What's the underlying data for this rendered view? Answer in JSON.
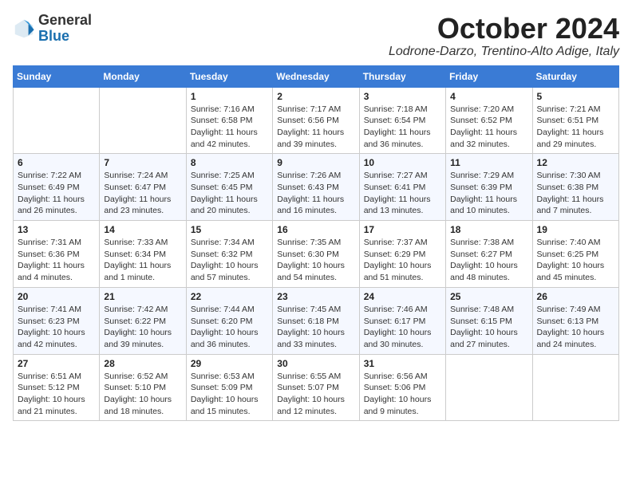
{
  "header": {
    "logo_general": "General",
    "logo_blue": "Blue",
    "month_title": "October 2024",
    "subtitle": "Lodrone-Darzo, Trentino-Alto Adige, Italy"
  },
  "days_of_week": [
    "Sunday",
    "Monday",
    "Tuesday",
    "Wednesday",
    "Thursday",
    "Friday",
    "Saturday"
  ],
  "weeks": [
    [
      {
        "day": "",
        "info": ""
      },
      {
        "day": "",
        "info": ""
      },
      {
        "day": "1",
        "info": "Sunrise: 7:16 AM\nSunset: 6:58 PM\nDaylight: 11 hours and 42 minutes."
      },
      {
        "day": "2",
        "info": "Sunrise: 7:17 AM\nSunset: 6:56 PM\nDaylight: 11 hours and 39 minutes."
      },
      {
        "day": "3",
        "info": "Sunrise: 7:18 AM\nSunset: 6:54 PM\nDaylight: 11 hours and 36 minutes."
      },
      {
        "day": "4",
        "info": "Sunrise: 7:20 AM\nSunset: 6:52 PM\nDaylight: 11 hours and 32 minutes."
      },
      {
        "day": "5",
        "info": "Sunrise: 7:21 AM\nSunset: 6:51 PM\nDaylight: 11 hours and 29 minutes."
      }
    ],
    [
      {
        "day": "6",
        "info": "Sunrise: 7:22 AM\nSunset: 6:49 PM\nDaylight: 11 hours and 26 minutes."
      },
      {
        "day": "7",
        "info": "Sunrise: 7:24 AM\nSunset: 6:47 PM\nDaylight: 11 hours and 23 minutes."
      },
      {
        "day": "8",
        "info": "Sunrise: 7:25 AM\nSunset: 6:45 PM\nDaylight: 11 hours and 20 minutes."
      },
      {
        "day": "9",
        "info": "Sunrise: 7:26 AM\nSunset: 6:43 PM\nDaylight: 11 hours and 16 minutes."
      },
      {
        "day": "10",
        "info": "Sunrise: 7:27 AM\nSunset: 6:41 PM\nDaylight: 11 hours and 13 minutes."
      },
      {
        "day": "11",
        "info": "Sunrise: 7:29 AM\nSunset: 6:39 PM\nDaylight: 11 hours and 10 minutes."
      },
      {
        "day": "12",
        "info": "Sunrise: 7:30 AM\nSunset: 6:38 PM\nDaylight: 11 hours and 7 minutes."
      }
    ],
    [
      {
        "day": "13",
        "info": "Sunrise: 7:31 AM\nSunset: 6:36 PM\nDaylight: 11 hours and 4 minutes."
      },
      {
        "day": "14",
        "info": "Sunrise: 7:33 AM\nSunset: 6:34 PM\nDaylight: 11 hours and 1 minute."
      },
      {
        "day": "15",
        "info": "Sunrise: 7:34 AM\nSunset: 6:32 PM\nDaylight: 10 hours and 57 minutes."
      },
      {
        "day": "16",
        "info": "Sunrise: 7:35 AM\nSunset: 6:30 PM\nDaylight: 10 hours and 54 minutes."
      },
      {
        "day": "17",
        "info": "Sunrise: 7:37 AM\nSunset: 6:29 PM\nDaylight: 10 hours and 51 minutes."
      },
      {
        "day": "18",
        "info": "Sunrise: 7:38 AM\nSunset: 6:27 PM\nDaylight: 10 hours and 48 minutes."
      },
      {
        "day": "19",
        "info": "Sunrise: 7:40 AM\nSunset: 6:25 PM\nDaylight: 10 hours and 45 minutes."
      }
    ],
    [
      {
        "day": "20",
        "info": "Sunrise: 7:41 AM\nSunset: 6:23 PM\nDaylight: 10 hours and 42 minutes."
      },
      {
        "day": "21",
        "info": "Sunrise: 7:42 AM\nSunset: 6:22 PM\nDaylight: 10 hours and 39 minutes."
      },
      {
        "day": "22",
        "info": "Sunrise: 7:44 AM\nSunset: 6:20 PM\nDaylight: 10 hours and 36 minutes."
      },
      {
        "day": "23",
        "info": "Sunrise: 7:45 AM\nSunset: 6:18 PM\nDaylight: 10 hours and 33 minutes."
      },
      {
        "day": "24",
        "info": "Sunrise: 7:46 AM\nSunset: 6:17 PM\nDaylight: 10 hours and 30 minutes."
      },
      {
        "day": "25",
        "info": "Sunrise: 7:48 AM\nSunset: 6:15 PM\nDaylight: 10 hours and 27 minutes."
      },
      {
        "day": "26",
        "info": "Sunrise: 7:49 AM\nSunset: 6:13 PM\nDaylight: 10 hours and 24 minutes."
      }
    ],
    [
      {
        "day": "27",
        "info": "Sunrise: 6:51 AM\nSunset: 5:12 PM\nDaylight: 10 hours and 21 minutes."
      },
      {
        "day": "28",
        "info": "Sunrise: 6:52 AM\nSunset: 5:10 PM\nDaylight: 10 hours and 18 minutes."
      },
      {
        "day": "29",
        "info": "Sunrise: 6:53 AM\nSunset: 5:09 PM\nDaylight: 10 hours and 15 minutes."
      },
      {
        "day": "30",
        "info": "Sunrise: 6:55 AM\nSunset: 5:07 PM\nDaylight: 10 hours and 12 minutes."
      },
      {
        "day": "31",
        "info": "Sunrise: 6:56 AM\nSunset: 5:06 PM\nDaylight: 10 hours and 9 minutes."
      },
      {
        "day": "",
        "info": ""
      },
      {
        "day": "",
        "info": ""
      }
    ]
  ]
}
